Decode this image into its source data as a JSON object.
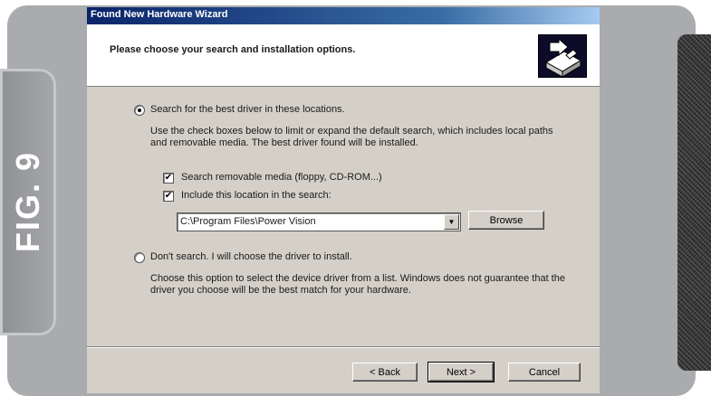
{
  "figure_label": "FIG. 9",
  "dialog": {
    "title": "Found New Hardware Wizard",
    "header_title": "Please choose your search and installation options.",
    "header_icon": "hardware-wizard-icon"
  },
  "options": {
    "search_radio_label": "Search for the best driver in these locations.",
    "search_description": "Use the check boxes below to limit or expand the default search, which includes local paths and removable media. The best driver found will be installed.",
    "removable_media_label": "Search removable media (floppy, CD-ROM...)",
    "include_location_label": "Include this location in the search:",
    "location_value": "C:\\Program Files\\Power Vision",
    "browse_label": "Browse",
    "dont_search_label": "Don't search. I will choose the driver to install.",
    "dont_search_description": "Choose this option to select the device driver from a list.  Windows does not guarantee that the driver you choose will be the best match for your hardware."
  },
  "footer": {
    "back_label": "< Back",
    "next_label": "Next >",
    "cancel_label": "Cancel"
  }
}
